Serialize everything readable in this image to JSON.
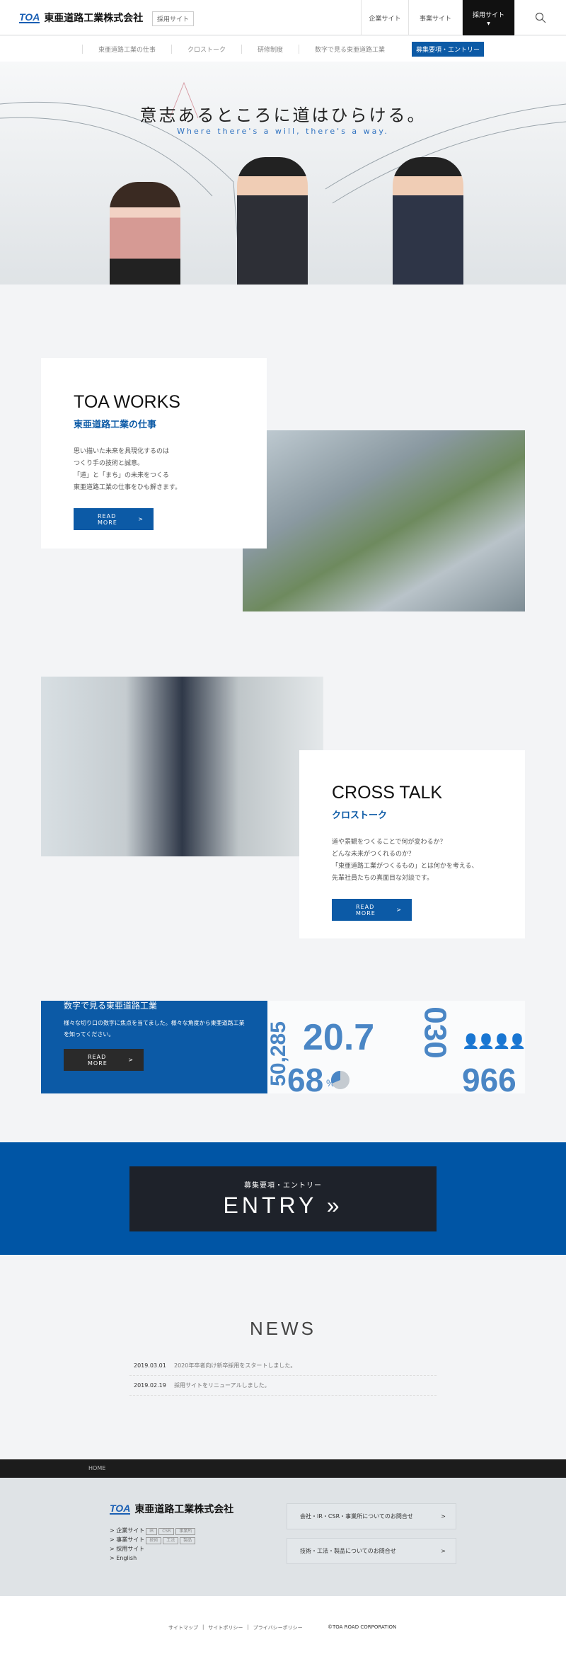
{
  "header": {
    "logo_mark": "TOA",
    "company": "東亜道路工業株式会社",
    "badge": "採用サイト",
    "nav": [
      "企業サイト",
      "事業サイト",
      "採用サイト"
    ],
    "active_caret": "▼",
    "search_icon": "search-icon"
  },
  "subnav": {
    "items": [
      "東亜道路工業の仕事",
      "クロストーク",
      "研修制度",
      "数字で見る東亜道路工業"
    ],
    "active": "募集要項・エントリー"
  },
  "hero": {
    "title": "意志あるところに道はひらける。",
    "subtitle": "Where there's a will, there's a way."
  },
  "works": {
    "en": "TOA WORKS",
    "ja": "東亜道路工業の仕事",
    "body": "思い描いた未来を具現化するのは\nつくり手の技術と誠意。\n「道」と「まち」の未来をつくる\n東亜道路工業の仕事をひも解きます。",
    "button": "READ MORE",
    "arrow": ">"
  },
  "crosstalk": {
    "en": "CROSS TALK",
    "ja": "クロストーク",
    "body": "道や景観をつくることで何が変わるか？\nどんな未来がつくれるのか？\n「東亜道路工業がつくるもの」とは何かを考える、\n先輩社員たちの真面目な対談です。",
    "button": "READ MORE",
    "arrow": ">"
  },
  "numbers": {
    "title": "数字で見る東亜道路工業",
    "body": "様々な切り口の数字に焦点を当てました。様々な角度から東亜道路工業を知ってください。",
    "button": "READ MORE",
    "arrow": ">",
    "figures": [
      "50,285",
      "20.7",
      "030",
      "68",
      "%",
      "966"
    ]
  },
  "entry": {
    "label": "募集要項・エントリー",
    "title": "ENTRY",
    "arrow": "»"
  },
  "news": {
    "title": "NEWS",
    "items": [
      {
        "date": "2019.03.01",
        "text": "2020年卒者向け新卒採用をスタートしました。"
      },
      {
        "date": "2019.02.19",
        "text": "採用サイトをリニューアルしました。"
      }
    ]
  },
  "breadcrumb": "HOME",
  "footer": {
    "logo_mark": "TOA",
    "company": "東亜道路工業株式会社",
    "links": [
      {
        "label": "企業サイト",
        "tags": [
          "IR",
          "CSR",
          "事業所"
        ]
      },
      {
        "label": "事業サイト",
        "tags": [
          "技術",
          "工法",
          "製品"
        ]
      },
      {
        "label": "採用サイト",
        "tags": []
      },
      {
        "label": "English",
        "tags": []
      }
    ],
    "contacts": [
      "会社・IR・CSR・事業所についてのお問合せ",
      "技術・工法・製品についてのお問合せ"
    ],
    "arrow": ">",
    "bottom_links": [
      "サイトマップ",
      "サイトポリシー",
      "プライバシーポリシー"
    ],
    "separator": "|",
    "copyright": "©TOA ROAD CORPORATION"
  },
  "colors": {
    "brand_blue": "#0c5aa6",
    "entry_band": "#0055a5",
    "dark": "#1e222a"
  }
}
